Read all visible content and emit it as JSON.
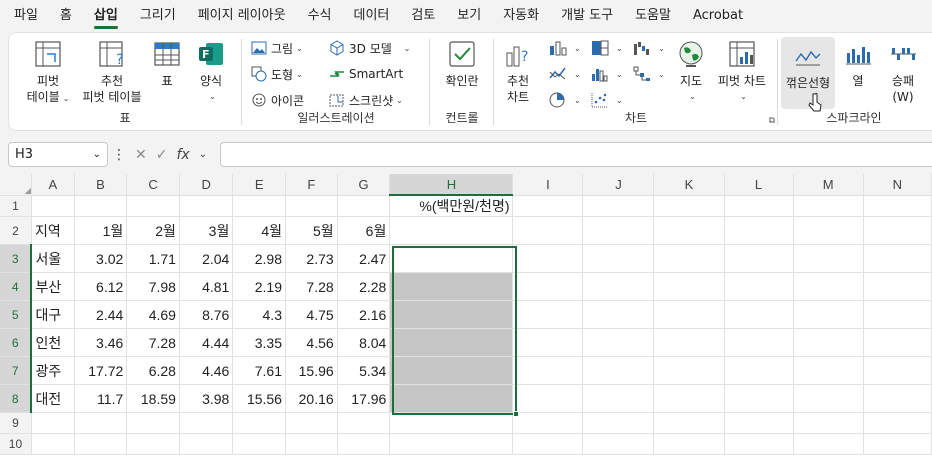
{
  "tabs": [
    "파일",
    "홈",
    "삽입",
    "그리기",
    "페이지 레이아웃",
    "수식",
    "데이터",
    "검토",
    "보기",
    "자동화",
    "개발 도구",
    "도움말",
    "Acrobat"
  ],
  "ribbon": {
    "tables": {
      "pivot_l1": "피벗",
      "pivot_l2": "테이블",
      "rec_pivot_l1": "추천",
      "rec_pivot_l2": "피벗 테이블",
      "table": "표",
      "form": "양식",
      "group": "표"
    },
    "illustrations": {
      "picture": "그림",
      "shape": "도형",
      "icon": "아이콘",
      "model3d": "3D 모델",
      "smartart": "SmartArt",
      "screenshot": "스크린샷",
      "group": "일러스트레이션"
    },
    "controls": {
      "checkbox": "확인란",
      "group": "컨트롤"
    },
    "charts": {
      "rec_l1": "추천",
      "rec_l2": "차트",
      "map": "지도",
      "pivot_chart": "피벗 차트",
      "group": "차트"
    },
    "sparklines": {
      "line": "꺾은선형",
      "column": "열",
      "winloss_l1": "승패",
      "winloss_l2": "(W)",
      "group": "스파크라인"
    }
  },
  "namebox": "H3",
  "formula": "",
  "columns": [
    "A",
    "B",
    "C",
    "D",
    "E",
    "F",
    "G",
    "H",
    "I",
    "J",
    "K",
    "L",
    "M",
    "N"
  ],
  "sheet": {
    "unit_label": "%(백만원/천명)",
    "headers": [
      "지역",
      "1월",
      "2월",
      "3월",
      "4월",
      "5월",
      "6월"
    ],
    "rows": [
      {
        "region": "서울",
        "values": [
          "3.02",
          "1.71",
          "2.04",
          "2.98",
          "2.73",
          "2.47"
        ]
      },
      {
        "region": "부산",
        "values": [
          "6.12",
          "7.98",
          "4.81",
          "2.19",
          "7.28",
          "2.28"
        ]
      },
      {
        "region": "대구",
        "values": [
          "2.44",
          "4.69",
          "8.76",
          "4.3",
          "4.75",
          "2.16"
        ]
      },
      {
        "region": "인천",
        "values": [
          "3.46",
          "7.28",
          "4.44",
          "3.35",
          "4.56",
          "8.04"
        ]
      },
      {
        "region": "광주",
        "values": [
          "17.72",
          "6.28",
          "4.46",
          "7.61",
          "15.96",
          "5.34"
        ]
      },
      {
        "region": "대전",
        "values": [
          "11.7",
          "18.59",
          "3.98",
          "15.56",
          "20.16",
          "17.96"
        ]
      }
    ]
  },
  "colors": {
    "accent": "#1e6e3c",
    "selection": "#c6c6c6"
  }
}
